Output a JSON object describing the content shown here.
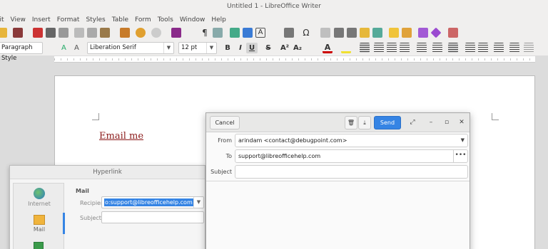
{
  "window": {
    "title": "Untitled 1 - LibreOffice Writer"
  },
  "menu": [
    "lit",
    "View",
    "Insert",
    "Format",
    "Styles",
    "Table",
    "Form",
    "Tools",
    "Window",
    "Help"
  ],
  "formatting": {
    "paragraph_style": "Paragraph Style",
    "font_name": "Liberation Serif",
    "font_size": "12 pt",
    "bold": "B",
    "italic": "I",
    "underline": "U",
    "strike": "S",
    "superscript": "A²",
    "subscript": "A₂"
  },
  "document": {
    "link_text": "Email me"
  },
  "hyperlink_dialog": {
    "title": "Hyperlink",
    "side_items": [
      "Internet",
      "Mail"
    ],
    "section": "Mail",
    "recipient_label": "Recipient:",
    "recipient_value": "o:support@libreofficehelp.com",
    "subject_label": "Subject:",
    "subject_value": ""
  },
  "mail_compose": {
    "cancel": "Cancel",
    "send": "Send",
    "from_label": "From",
    "from_value": "arindam <contact@debugpoint.com>",
    "to_label": "To",
    "to_value": "support@libreofficehelp.com",
    "subject_label": "Subject",
    "subject_value": ""
  },
  "colors": {
    "accent": "#3584e4",
    "link": "#8b1a1a"
  }
}
